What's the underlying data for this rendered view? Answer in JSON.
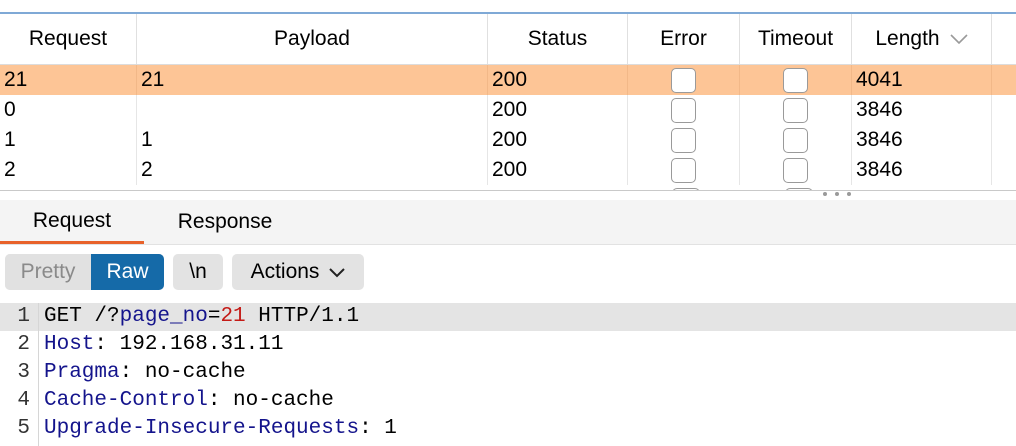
{
  "table": {
    "columns": {
      "request": "Request",
      "payload": "Payload",
      "status": "Status",
      "error": "Error",
      "timeout": "Timeout",
      "length": "Length"
    },
    "rows": [
      {
        "request": "21",
        "payload": "21",
        "status": "200",
        "length": "4041",
        "selected": true
      },
      {
        "request": "0",
        "payload": "",
        "status": "200",
        "length": "3846",
        "selected": false
      },
      {
        "request": "1",
        "payload": "1",
        "status": "200",
        "length": "3846",
        "selected": false
      },
      {
        "request": "2",
        "payload": "2",
        "status": "200",
        "length": "3846",
        "selected": false
      }
    ],
    "sort_icon": "chevron-down-icon"
  },
  "tabs": {
    "request": "Request",
    "response": "Response",
    "active": "request"
  },
  "toolbar": {
    "pretty": "Pretty",
    "raw": "Raw",
    "newline": "\\n",
    "actions": "Actions",
    "active_view": "raw"
  },
  "editor": {
    "lines": [
      {
        "num": "1",
        "parts": [
          {
            "t": "GET /?",
            "c": ""
          },
          {
            "t": "page_no",
            "c": "key"
          },
          {
            "t": "=",
            "c": ""
          },
          {
            "t": "21",
            "c": "num"
          },
          {
            "t": " HTTP/1.1",
            "c": ""
          }
        ]
      },
      {
        "num": "2",
        "parts": [
          {
            "t": "Host",
            "c": "key"
          },
          {
            "t": ": 192.168.31.11",
            "c": ""
          }
        ]
      },
      {
        "num": "3",
        "parts": [
          {
            "t": "Pragma",
            "c": "key"
          },
          {
            "t": ": no-cache",
            "c": ""
          }
        ]
      },
      {
        "num": "4",
        "parts": [
          {
            "t": "Cache-Control",
            "c": "key"
          },
          {
            "t": ": no-cache",
            "c": ""
          }
        ]
      },
      {
        "num": "5",
        "parts": [
          {
            "t": "Upgrade-Insecure-Requests",
            "c": "key"
          },
          {
            "t": ": 1",
            "c": ""
          }
        ]
      }
    ]
  },
  "colors": {
    "selected_row": "#fdc596",
    "active_tab_underline": "#e8622a",
    "raw_button": "#156aa8",
    "header_key": "#14148c",
    "number": "#c41a16"
  }
}
